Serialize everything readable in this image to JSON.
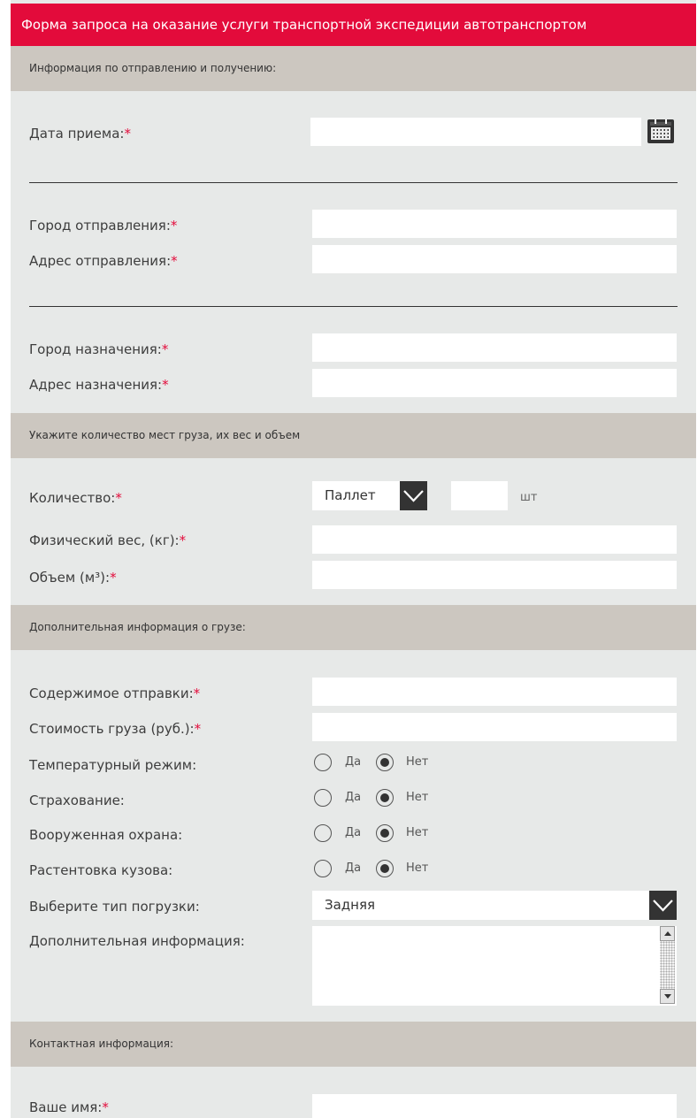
{
  "title": "Форма запроса на оказание услуги транспортной экспедиции автотранспортом",
  "sections": {
    "shipping": "Информация по отправлению и получению:",
    "cargo": "Укажите количество мест груза, их вес и объем",
    "extra": "Дополнительная информация о грузе:",
    "contact": "Контактная информация:"
  },
  "fields": {
    "date": "Дата приема:",
    "from_city": "Город отправления:",
    "from_address": "Адрес отправления:",
    "to_city": "Город назначения:",
    "to_address": "Адрес назначения:",
    "quantity": "Количество:",
    "weight": "Физический вес, (кг):",
    "volume": "Объем (м³):",
    "contents": "Содержимое отправки:",
    "cost": "Стоимость груза (руб.):",
    "temperature": "Температурный режим:",
    "insurance": "Страхование:",
    "guard": "Вооруженная охрана:",
    "tent": "Растентовка кузова:",
    "loading": "Выберите тип погрузки:",
    "info": "Дополнительная информация:",
    "name": "Ваше имя:"
  },
  "required_mark": "*",
  "quantity_unit_select": "Паллет",
  "quantity_count": "",
  "quantity_unit_label": "шт",
  "loading_type": "Задняя",
  "radio_labels": {
    "yes": "Да",
    "no": "Нет"
  },
  "radios": {
    "temperature": "no",
    "insurance": "no",
    "guard": "no",
    "tent": "no"
  },
  "colors": {
    "accent": "#e30b3b",
    "panel": "#e7e9e8",
    "section": "#ccc7c0"
  },
  "icons": {
    "calendar": "calendar-icon",
    "dropdown": "chevron-down-icon"
  }
}
